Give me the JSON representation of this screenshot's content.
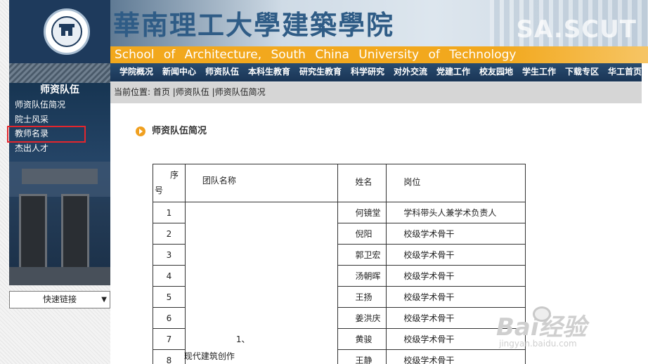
{
  "header": {
    "cn_title": "華南理工大學建築學院",
    "watermark_text": "SA.SCUT",
    "en_title": "School of Architecture, South China University of Technology"
  },
  "top_menu": {
    "items": [
      "学院概况",
      "新闻中心",
      "师资队伍",
      "本科生教育",
      "研究生教育",
      "科学研究",
      "对外交流",
      "党建工作",
      "校友园地",
      "学生工作",
      "下载专区",
      "华工首页"
    ]
  },
  "sidebar": {
    "title": "师资队伍",
    "items": [
      "师资队伍简况",
      "院士风采",
      "教师名录",
      "杰出人才"
    ],
    "highlighted_item": "教师名录",
    "quick_link_label": "快速链接",
    "quick_link_arrow": "▼"
  },
  "breadcrumb": {
    "prefix": "当前位置:",
    "home": "首页",
    "sep": "|",
    "level1": "师资队伍",
    "level2": "师资队伍简况"
  },
  "section": {
    "title": "师资队伍简况"
  },
  "table": {
    "headers": {
      "no_part1": "序",
      "no_part2": "号",
      "team": "团队名称",
      "name": "姓名",
      "position": "岗位"
    },
    "team_number": "1、",
    "team_name": "现代建筑创作",
    "rows": [
      {
        "no": "1",
        "name": "何镜堂",
        "position": "学科带头人兼学术负责人"
      },
      {
        "no": "2",
        "name": "倪阳",
        "position": "校级学术骨干"
      },
      {
        "no": "3",
        "name": "郭卫宏",
        "position": "校级学术骨干"
      },
      {
        "no": "4",
        "name": "汤朝晖",
        "position": "校级学术骨干"
      },
      {
        "no": "5",
        "name": "王扬",
        "position": "校级学术骨干"
      },
      {
        "no": "6",
        "name": "姜洪庆",
        "position": "校级学术骨干"
      },
      {
        "no": "7",
        "name": "黄骏",
        "position": "校级学术骨干"
      },
      {
        "no": "8",
        "name": "王静",
        "position": "校级学术骨干"
      }
    ]
  },
  "watermark": {
    "brand": "Bai经验",
    "url": "jingyan.baidu.com"
  },
  "colors": {
    "navy": "#1e3a5c",
    "orange_band": "#f2a81d",
    "highlight_red": "#e3262d",
    "crumb_gray": "#d6d6d6"
  }
}
